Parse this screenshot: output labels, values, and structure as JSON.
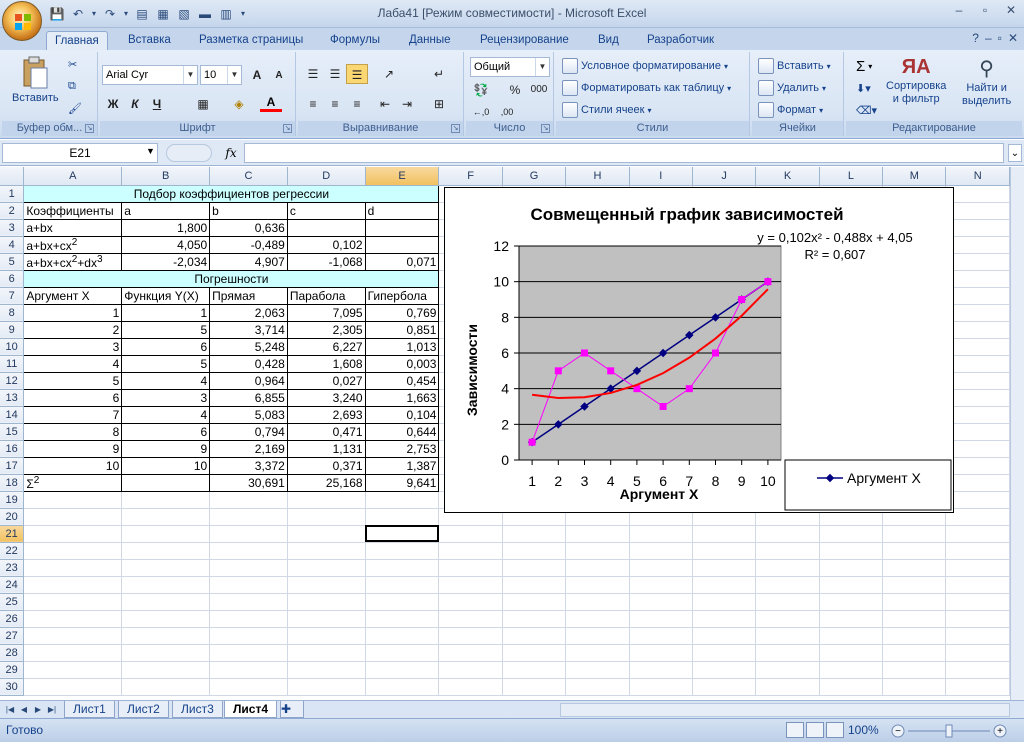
{
  "window": {
    "title": "Лаба41  [Режим совместимости] - Microsoft Excel"
  },
  "ribbon_tabs": [
    "Главная",
    "Вставка",
    "Разметка страницы",
    "Формулы",
    "Данные",
    "Рецензирование",
    "Вид",
    "Разработчик"
  ],
  "ribbon": {
    "clipboard": {
      "paste": "Вставить",
      "label": "Буфер обм..."
    },
    "font": {
      "name": "Arial Cyr",
      "size": "10",
      "bold": "Ж",
      "italic": "К",
      "underline": "Ч",
      "grow": "A",
      "shrink": "A",
      "color_letter": "A",
      "label": "Шрифт"
    },
    "alignment": {
      "label": "Выравнивание"
    },
    "number": {
      "format": "Общий",
      "percent": "%",
      "thousands": "000",
      "label": "Число"
    },
    "styles": {
      "cond": "Условное форматирование",
      "table": "Форматировать как таблицу",
      "cell": "Стили ячеек",
      "label": "Стили"
    },
    "cells": {
      "insert": "Вставить",
      "delete": "Удалить",
      "format": "Формат",
      "label": "Ячейки"
    },
    "editing": {
      "sigma": "Σ",
      "sort": "Сортировка",
      "sort2": "и фильтр",
      "find": "Найти и",
      "find2": "выделить",
      "label": "Редактирование"
    }
  },
  "formula_bar": {
    "name_box": "E21",
    "fx": "fx",
    "value": ""
  },
  "columns": [
    "A",
    "B",
    "C",
    "D",
    "E",
    "F",
    "G",
    "H",
    "I",
    "J",
    "K",
    "L",
    "M",
    "N"
  ],
  "rows": [
    [
      "",
      "Подбор коэффициентов регрессии",
      "",
      "",
      ""
    ],
    [
      "Коэффициенты",
      "a",
      "b",
      "c",
      "d"
    ],
    [
      "a+bx",
      "1,800",
      "0,636",
      "",
      ""
    ],
    [
      "a+bx+cx2",
      "4,050",
      "-0,489",
      "0,102",
      ""
    ],
    [
      "a+bx+cx2+dx3",
      "-2,034",
      "4,907",
      "-1,068",
      "0,071"
    ],
    [
      "",
      "Погрешности",
      "",
      "",
      ""
    ],
    [
      "Аргумент X",
      "Функция Y(X)",
      "Прямая",
      "Парабола",
      "Гипербола"
    ],
    [
      "1",
      "1",
      "2,063",
      "7,095",
      "0,769"
    ],
    [
      "2",
      "5",
      "3,714",
      "2,305",
      "0,851"
    ],
    [
      "3",
      "6",
      "5,248",
      "6,227",
      "1,013"
    ],
    [
      "4",
      "5",
      "0,428",
      "1,608",
      "0,003"
    ],
    [
      "5",
      "4",
      "0,964",
      "0,027",
      "0,454"
    ],
    [
      "6",
      "3",
      "6,855",
      "3,240",
      "1,663"
    ],
    [
      "7",
      "4",
      "5,083",
      "2,693",
      "0,104"
    ],
    [
      "8",
      "6",
      "0,794",
      "0,471",
      "0,644"
    ],
    [
      "9",
      "9",
      "2,169",
      "1,131",
      "2,753"
    ],
    [
      "10",
      "10",
      "3,372",
      "0,371",
      "1,387"
    ],
    [
      "Σ2",
      "",
      "30,691",
      "25,168",
      "9,641"
    ]
  ],
  "row_count": 30,
  "selected_cell": "E21",
  "chart": {
    "title": "Совмещенный график зависимостей",
    "equation": "y = 0,102x² - 0,488x + 4,05",
    "r2": "R² = 0,607",
    "xlabel": "Аргумент X",
    "ylabel": "Зависимости",
    "legend": "Аргумент X"
  },
  "chart_data": {
    "type": "line",
    "title": "Совмещенный график зависимостей",
    "xlabel": "Аргумент X",
    "ylabel": "Зависимости",
    "categories": [
      1,
      2,
      3,
      4,
      5,
      6,
      7,
      8,
      9,
      10
    ],
    "ylim": [
      0,
      12
    ],
    "yticks": [
      0,
      2,
      4,
      6,
      8,
      10,
      12
    ],
    "series": [
      {
        "name": "Аргумент X",
        "color": "#000080",
        "marker": "diamond",
        "values": [
          1,
          2,
          3,
          4,
          5,
          6,
          7,
          8,
          9,
          10
        ]
      },
      {
        "color": "#ff00ff",
        "marker": "square",
        "values": [
          1,
          5,
          6,
          5,
          4,
          3,
          4,
          6,
          9,
          10
        ]
      },
      {
        "color": "#ff0000",
        "marker": "none",
        "trend": "poly2",
        "values": [
          3.66,
          3.48,
          3.52,
          3.76,
          4.21,
          4.87,
          5.74,
          6.81,
          8.09,
          9.58
        ]
      }
    ],
    "grid": true,
    "legend_position": "right"
  },
  "sheets": [
    "Лист1",
    "Лист2",
    "Лист3",
    "Лист4"
  ],
  "active_sheet": "Лист4",
  "status": {
    "ready": "Готово",
    "zoom": "100%"
  },
  "colors": {
    "accent": "#15428b",
    "header_fill": "#ccffff",
    "plot_bg": "#c0c0c0"
  }
}
